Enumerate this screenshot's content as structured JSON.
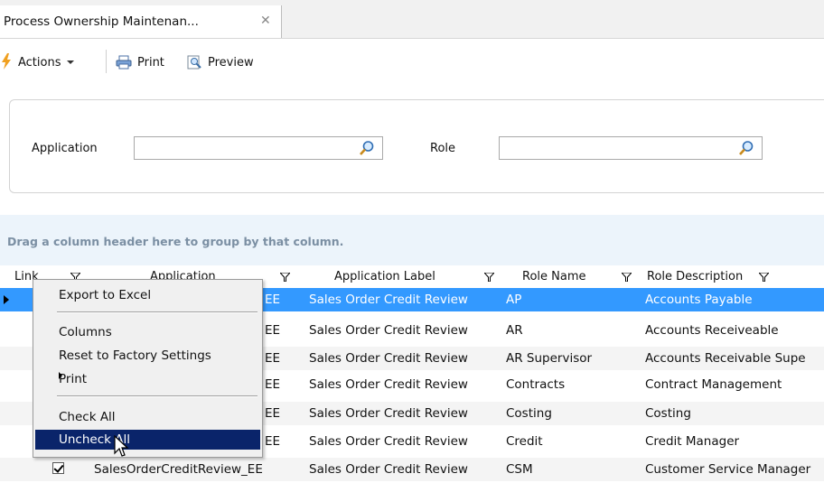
{
  "tab": {
    "title": "Process Ownership Maintenan...",
    "close": "✕"
  },
  "toolbar": {
    "actions_label": "Actions",
    "print_label": "Print",
    "preview_label": "Preview"
  },
  "filter": {
    "application_label": "Application",
    "application_value": "",
    "role_label": "Role",
    "role_value": ""
  },
  "grid": {
    "group_hint": "Drag a column header here to group by that column.",
    "columns": [
      "Link",
      "Application",
      "Application Label",
      "Role Name",
      "Role Description"
    ],
    "rows": [
      {
        "application": "SalesOrderCreditReview_EE",
        "application_label": "Sales Order Credit Review",
        "role_name": "AP",
        "role_description": "Accounts Payable"
      },
      {
        "application": "SalesOrderCreditReview_EE",
        "application_label": "Sales Order Credit Review",
        "role_name": "AR",
        "role_description": "Accounts Receiveable"
      },
      {
        "application": "SalesOrderCreditReview_EE",
        "application_label": "Sales Order Credit Review",
        "role_name": "AR Supervisor",
        "role_description": "Accounts Receivable Supe"
      },
      {
        "application": "SalesOrderCreditReview_EE",
        "application_label": "Sales Order Credit Review",
        "role_name": "Contracts",
        "role_description": "Contract Management"
      },
      {
        "application": "SalesOrderCreditReview_EE",
        "application_label": "Sales Order Credit Review",
        "role_name": "Costing",
        "role_description": "Costing"
      },
      {
        "application": "SalesOrderCreditReview_EE",
        "application_label": "Sales Order Credit Review",
        "role_name": "Credit",
        "role_description": "Credit Manager"
      },
      {
        "application": "SalesOrderCreditReview_EE",
        "application_label": "Sales Order Credit Review",
        "role_name": "CSM",
        "role_description": "Customer Service Manager"
      }
    ],
    "row_suffix": "EE"
  },
  "context_menu": {
    "export": "Export to Excel",
    "columns": "Columns",
    "reset": "Reset to Factory Settings",
    "print": "Print",
    "check_all": "Check All",
    "uncheck_all": "Uncheck All"
  },
  "colors": {
    "selected_row": "#3399ff",
    "menu_highlight": "#0a246a",
    "group_panel": "#ecf4fb"
  }
}
